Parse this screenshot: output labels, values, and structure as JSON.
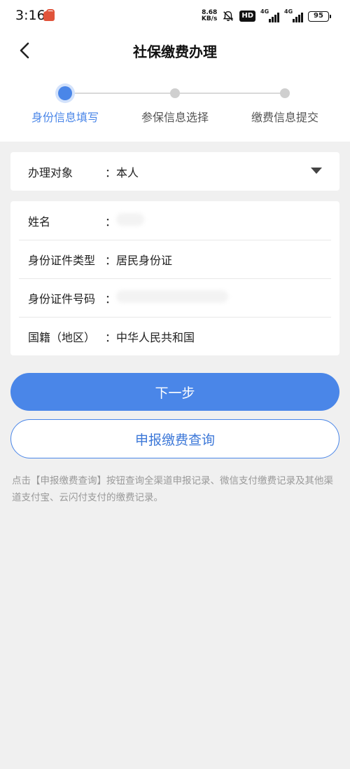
{
  "status_bar": {
    "time": "3:16",
    "net_speed_value": "8.68",
    "net_speed_unit": "KB/s",
    "hd_label": "HD",
    "signal1_tag": "4G",
    "signal2_tag": "4G",
    "battery": "95"
  },
  "header": {
    "title": "社保缴费办理"
  },
  "steps": [
    {
      "label": "身份信息填写",
      "active": true
    },
    {
      "label": "参保信息选择",
      "active": false
    },
    {
      "label": "缴费信息提交",
      "active": false
    }
  ],
  "target_card": {
    "label": "办理对象",
    "colon": "：",
    "value": "本人"
  },
  "identity_card": {
    "name_label": "姓名",
    "name_colon": "：",
    "id_type_label": "身份证件类型",
    "id_type_colon": "：",
    "id_type_value": "居民身份证",
    "id_number_label": "身份证件号码",
    "id_number_colon": "：",
    "nationality_label": "国籍（地区）",
    "nationality_colon": "：",
    "nationality_value": "中华人民共和国"
  },
  "buttons": {
    "next": "下一步",
    "query": "申报缴费查询"
  },
  "note": "点击【申报缴费查询】按钮查询全渠道申报记录、微信支付缴费记录及其他渠道支付宝、云闪付支付的缴费记录。",
  "colors": {
    "accent": "#4a86e8",
    "background": "#f0f0f0"
  }
}
